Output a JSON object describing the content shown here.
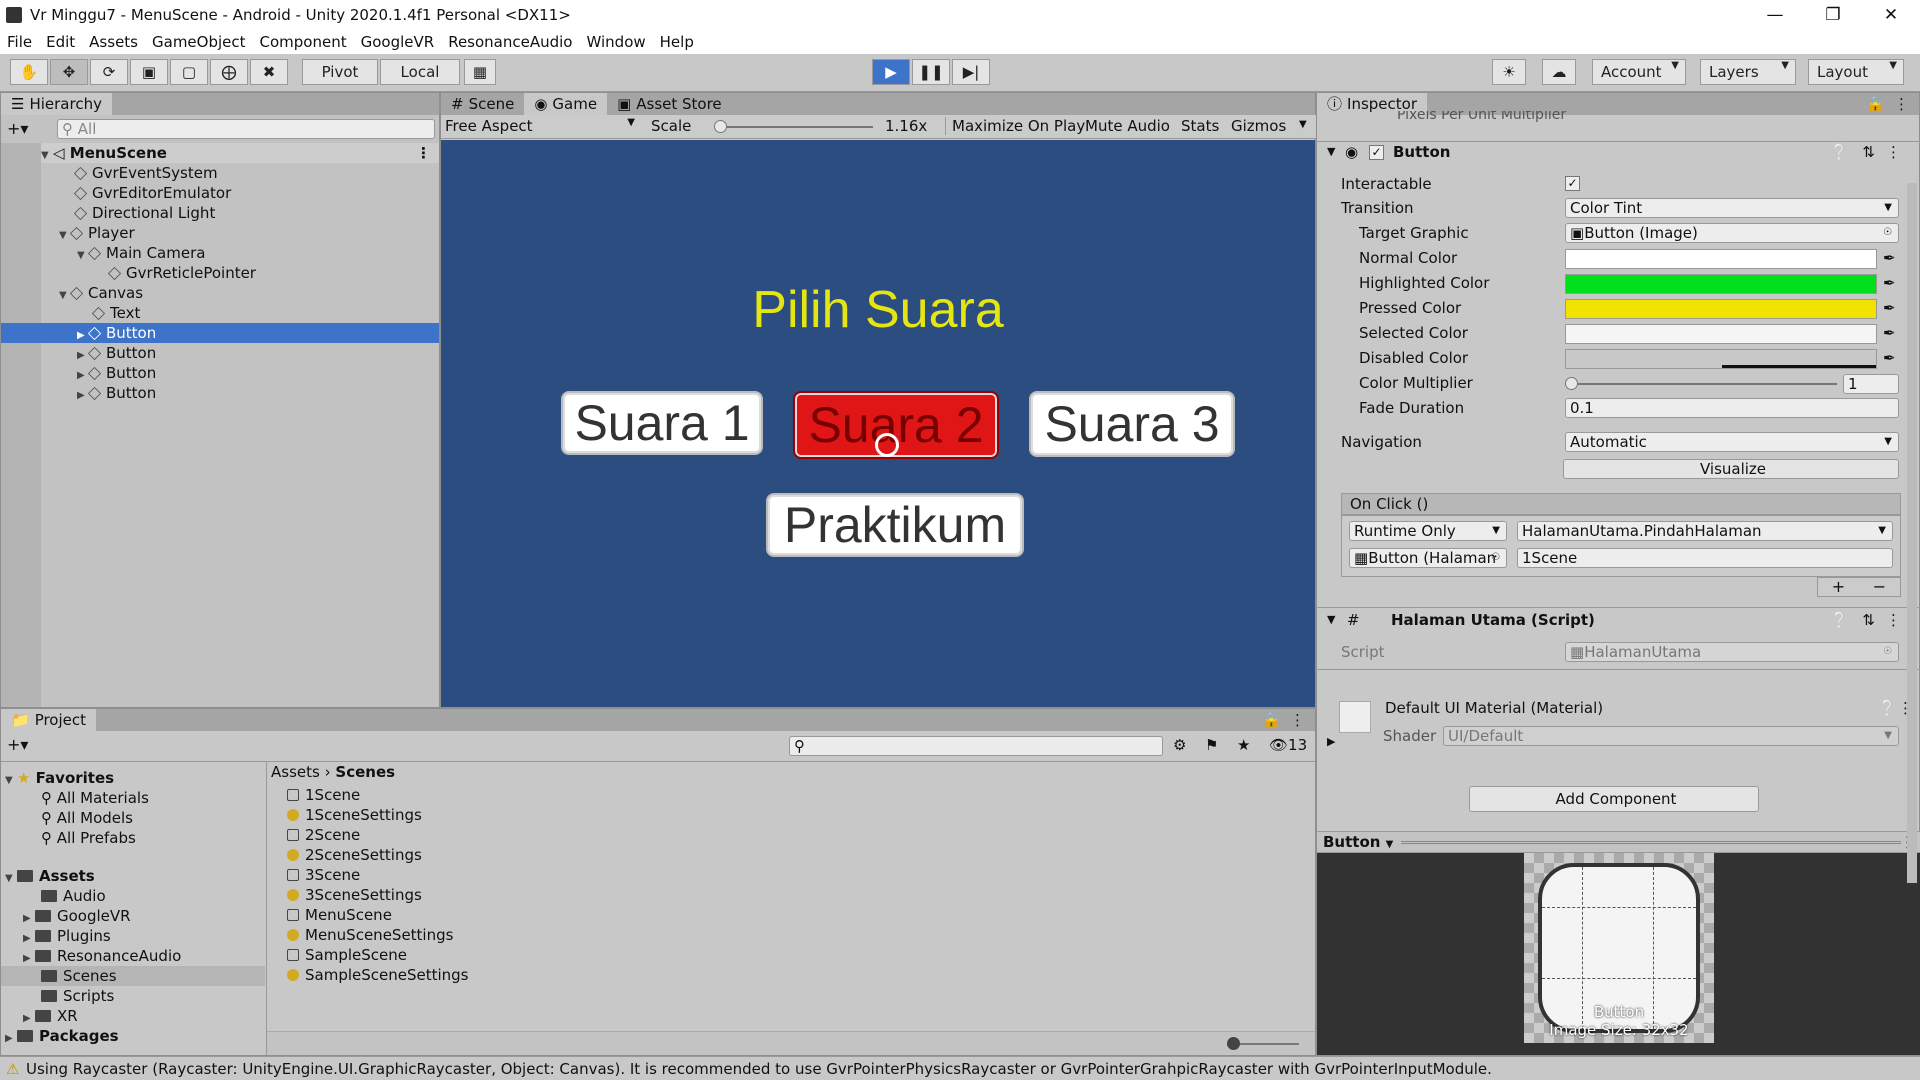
{
  "window": {
    "title": "Vr Minggu7 - MenuScene - Android - Unity 2020.1.4f1 Personal <DX11>"
  },
  "menu": [
    "File",
    "Edit",
    "Assets",
    "GameObject",
    "Component",
    "GoogleVR",
    "ResonanceAudio",
    "Window",
    "Help"
  ],
  "toolbar": {
    "pivot": "Pivot",
    "local": "Local",
    "account": "Account",
    "layers": "Layers",
    "layout": "Layout"
  },
  "hierarchy": {
    "tab": "Hierarchy",
    "search_placeholder": "All",
    "scene": "MenuScene",
    "items": [
      "GvrEventSystem",
      "GvrEditorEmulator",
      "Directional Light",
      "Player",
      "Main Camera",
      "GvrReticlePointer",
      "Canvas",
      "Text",
      "Button",
      "Button",
      "Button",
      "Button"
    ]
  },
  "center": {
    "tabs": [
      "Scene",
      "Game",
      "Asset Store"
    ],
    "aspect": "Free Aspect",
    "scale_label": "Scale",
    "scale_value": "1.16x",
    "scale_fraction": 0.02,
    "options": [
      "Maximize On Play",
      "Mute Audio",
      "Stats",
      "Gizmos"
    ]
  },
  "game": {
    "title": "Pilih Suara",
    "buttons": [
      "Suara 1",
      "Suara 2",
      "Suara 3"
    ],
    "praktikum": "Praktikum",
    "colors": {
      "background": "#2c4d80",
      "title": "#e5e511",
      "highlight": "#e01515"
    }
  },
  "inspector": {
    "tab": "Inspector",
    "top_field": "Pixels Per Unit Multiplier",
    "component": "Button",
    "interactable_label": "Interactable",
    "transition_label": "Transition",
    "transition_value": "Color Tint",
    "target_graphic_label": "Target Graphic",
    "target_graphic_value": "Button (Image)",
    "colors": [
      {
        "label": "Normal Color",
        "value": "#ffffff"
      },
      {
        "label": "Highlighted Color",
        "value": "#00e01c"
      },
      {
        "label": "Pressed Color",
        "value": "#f2e200"
      },
      {
        "label": "Selected Color",
        "value": "#f5f5f5"
      },
      {
        "label": "Disabled Color",
        "value": "#c8c8c8"
      }
    ],
    "color_multiplier_label": "Color Multiplier",
    "color_multiplier_value": "1",
    "fade_label": "Fade Duration",
    "fade_value": "0.1",
    "navigation_label": "Navigation",
    "navigation_value": "Automatic",
    "visualize": "Visualize",
    "onclick_label": "On Click ()",
    "runtime": "Runtime Only",
    "method": "HalamanUtama.PindahHalaman",
    "object": "Button (Halaman",
    "argument": "1Scene",
    "script_component": "Halaman Utama (Script)",
    "script_label": "Script",
    "script_value": "HalamanUtama",
    "material": "Default UI Material (Material)",
    "shader_label": "Shader",
    "shader_value": "UI/Default",
    "add_component": "Add Component",
    "preview_label": "Button",
    "preview_caption": "Button",
    "preview_size": "Image Size: 32x32"
  },
  "project": {
    "tab": "Project",
    "count": "13",
    "favorites": "Favorites",
    "fav_items": [
      "All Materials",
      "All Models",
      "All Prefabs"
    ],
    "assets": "Assets",
    "asset_folders": [
      "Audio",
      "GoogleVR",
      "Plugins",
      "ResonanceAudio",
      "Scenes",
      "Scripts",
      "XR"
    ],
    "packages": "Packages",
    "breadcrumb": [
      "Assets",
      "Scenes"
    ],
    "files": [
      {
        "name": "1Scene",
        "type": "scene"
      },
      {
        "name": "1SceneSettings",
        "type": "settings"
      },
      {
        "name": "2Scene",
        "type": "scene"
      },
      {
        "name": "2SceneSettings",
        "type": "settings"
      },
      {
        "name": "3Scene",
        "type": "scene"
      },
      {
        "name": "3SceneSettings",
        "type": "settings"
      },
      {
        "name": "MenuScene",
        "type": "scene"
      },
      {
        "name": "MenuSceneSettings",
        "type": "settings"
      },
      {
        "name": "SampleScene",
        "type": "scene"
      },
      {
        "name": "SampleSceneSettings",
        "type": "settings"
      }
    ]
  },
  "status": "Using Raycaster (Raycaster: UnityEngine.UI.GraphicRaycaster, Object: Canvas). It is recommended to use GvrPointerPhysicsRaycaster or GvrPointerGrahpicRaycaster with GvrPointerInputModule."
}
